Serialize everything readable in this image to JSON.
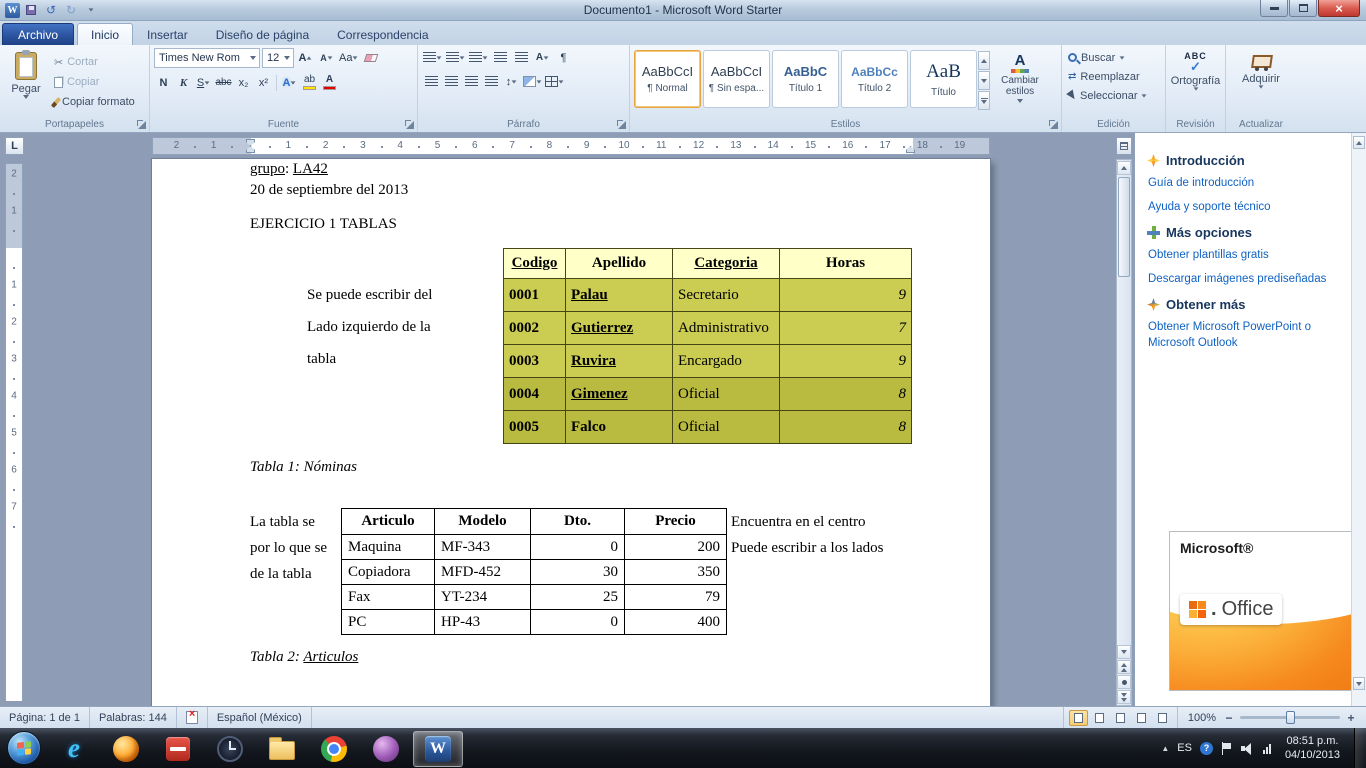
{
  "window": {
    "title": "Documento1  -  Microsoft Word Starter"
  },
  "ribbon": {
    "file_tab": "Archivo",
    "active_tab": "Inicio",
    "tabs": [
      "Inicio",
      "Insertar",
      "Diseño de página",
      "Correspondencia"
    ],
    "clipboard": {
      "label": "Portapapeles",
      "paste": "Pegar",
      "cut": "Cortar",
      "copy": "Copiar",
      "format_painter": "Copiar formato"
    },
    "font": {
      "label": "Fuente",
      "font_name": "Times New Rom",
      "font_size": "12",
      "bold": "N",
      "italic": "K",
      "underline": "S",
      "strikethrough": "abc",
      "subscript": "x₂",
      "superscript": "x²",
      "change_case": "Aa"
    },
    "paragraph": {
      "label": "Párrafo",
      "pilcrow": "¶",
      "sort": "A"
    },
    "styles": {
      "label": "Estilos",
      "change_styles": "Cambiar estilos",
      "gallery": [
        {
          "preview": "AaBbCcI",
          "name": "¶ Normal",
          "selected": true
        },
        {
          "preview": "AaBbCcI",
          "name": "¶ Sin espa...",
          "selected": false
        },
        {
          "preview": "AaBbC",
          "name": "Título 1",
          "selected": false
        },
        {
          "preview": "AaBbCc",
          "name": "Título 2",
          "selected": false
        },
        {
          "preview": "AaB",
          "name": "Título",
          "selected": false
        }
      ]
    },
    "editing": {
      "label": "Edición",
      "find": "Buscar",
      "replace": "Reemplazar",
      "select": "Seleccionar"
    },
    "proofing": {
      "label": "Revisión",
      "spelling": "Ortografía",
      "abc": "ABC"
    },
    "update": {
      "label": "Actualizar",
      "acquire": "Adquirir"
    }
  },
  "ruler": {
    "h_margin_numbers": [
      "2",
      "1"
    ],
    "h_numbers": [
      "1",
      "2",
      "3",
      "4",
      "5",
      "6",
      "7",
      "8",
      "9",
      "10",
      "11",
      "12",
      "13",
      "14",
      "15",
      "16",
      "17",
      "18",
      "19"
    ],
    "v_margin_numbers": [
      "2",
      "1"
    ],
    "v_numbers": [
      "1",
      "2",
      "3",
      "4",
      "5",
      "6",
      "7"
    ]
  },
  "document": {
    "underlined_cells": [
      "Codigo",
      "Categoria",
      "Palau",
      "Gutierrez",
      "Ruvira",
      "Gimenez"
    ],
    "paragraphs": [
      {
        "segments": [
          {
            "t": "grupo",
            "u": true
          },
          {
            "t": ": "
          },
          {
            "t": "LA42",
            "u": true
          }
        ]
      },
      {
        "segments": [
          {
            "t": "20 de septiembre del 2013"
          }
        ]
      },
      {
        "segments": [
          {
            "t": "EJERCICIO 1 TABLAS"
          }
        ]
      }
    ],
    "table1_note": [
      "Se puede escribir del",
      "Lado izquierdo de la",
      "tabla"
    ],
    "table1": {
      "headers": [
        "Codigo",
        "Apellido",
        "Categoria",
        "Horas"
      ],
      "rows": [
        [
          "0001",
          "Palau",
          "Secretario",
          "9"
        ],
        [
          "0002",
          "Gutierrez",
          "Administrativo",
          "7"
        ],
        [
          "0003",
          "Ruvira",
          "Encargado",
          "9"
        ],
        [
          "0004",
          "Gimenez",
          "Oficial",
          "8"
        ],
        [
          "0005",
          "Falco",
          "Oficial",
          "8"
        ]
      ],
      "caption_segments": [
        {
          "t": "Tabla 1: Nóminas",
          "i": true
        }
      ]
    },
    "table2_note_left": [
      "La tabla se",
      "por lo que se",
      "de la tabla"
    ],
    "table2_note_right": [
      "Encuentra en el centro",
      "Puede escribir a los lados"
    ],
    "table2": {
      "headers": [
        "Articulo",
        "Modelo",
        "Dto.",
        "Precio"
      ],
      "rows": [
        [
          "Maquina",
          "MF-343",
          "0",
          "200"
        ],
        [
          "Copiadora",
          "MFD-452",
          "30",
          "350"
        ],
        [
          "Fax",
          "YT-234",
          "25",
          "79"
        ],
        [
          "PC",
          "HP-43",
          "0",
          "400"
        ]
      ],
      "caption_segments": [
        {
          "t": "Tabla 2: ",
          "i": true
        },
        {
          "t": "Articulos",
          "i": true,
          "u": true
        }
      ]
    }
  },
  "taskpane": {
    "sections": [
      {
        "title": "Introducción",
        "icon": "burst",
        "links": [
          "Guía de introducción",
          "Ayuda y soporte técnico"
        ]
      },
      {
        "title": "Más opciones",
        "icon": "plus",
        "links": [
          "Obtener plantillas gratis",
          "Descargar imágenes prediseñadas"
        ]
      },
      {
        "title": "Obtener más",
        "icon": "star",
        "links": [
          "Obtener Microsoft PowerPoint o Microsoft Outlook"
        ]
      }
    ],
    "ad": {
      "brand": "Microsoft®",
      "product": "Office"
    }
  },
  "statusbar": {
    "page": "Página: 1 de 1",
    "words": "Palabras: 144",
    "language": "Español (México)",
    "zoom": "100%"
  },
  "taskbar": {
    "apps": [
      {
        "name": "internet-explorer",
        "style": "ie",
        "glyph": "e"
      },
      {
        "name": "firefox",
        "style": "firefox"
      },
      {
        "name": "red-app",
        "style": "red"
      },
      {
        "name": "clock-app",
        "style": "clock"
      },
      {
        "name": "folder",
        "style": "folder"
      },
      {
        "name": "chrome",
        "style": "chrome"
      },
      {
        "name": "media-app",
        "style": "purple"
      },
      {
        "name": "word",
        "style": "word",
        "glyph": "W",
        "active": true
      }
    ],
    "tray": {
      "language": "ES",
      "time": "08:51 p.m.",
      "date": "04/10/2013"
    }
  },
  "colors": {
    "accent_blue": "#2b579a",
    "table1_header": "#ffffc8",
    "table1_row_light": "#cbcc52",
    "table1_row_dark": "#b9ba40",
    "office_orange": "#f6891f"
  }
}
